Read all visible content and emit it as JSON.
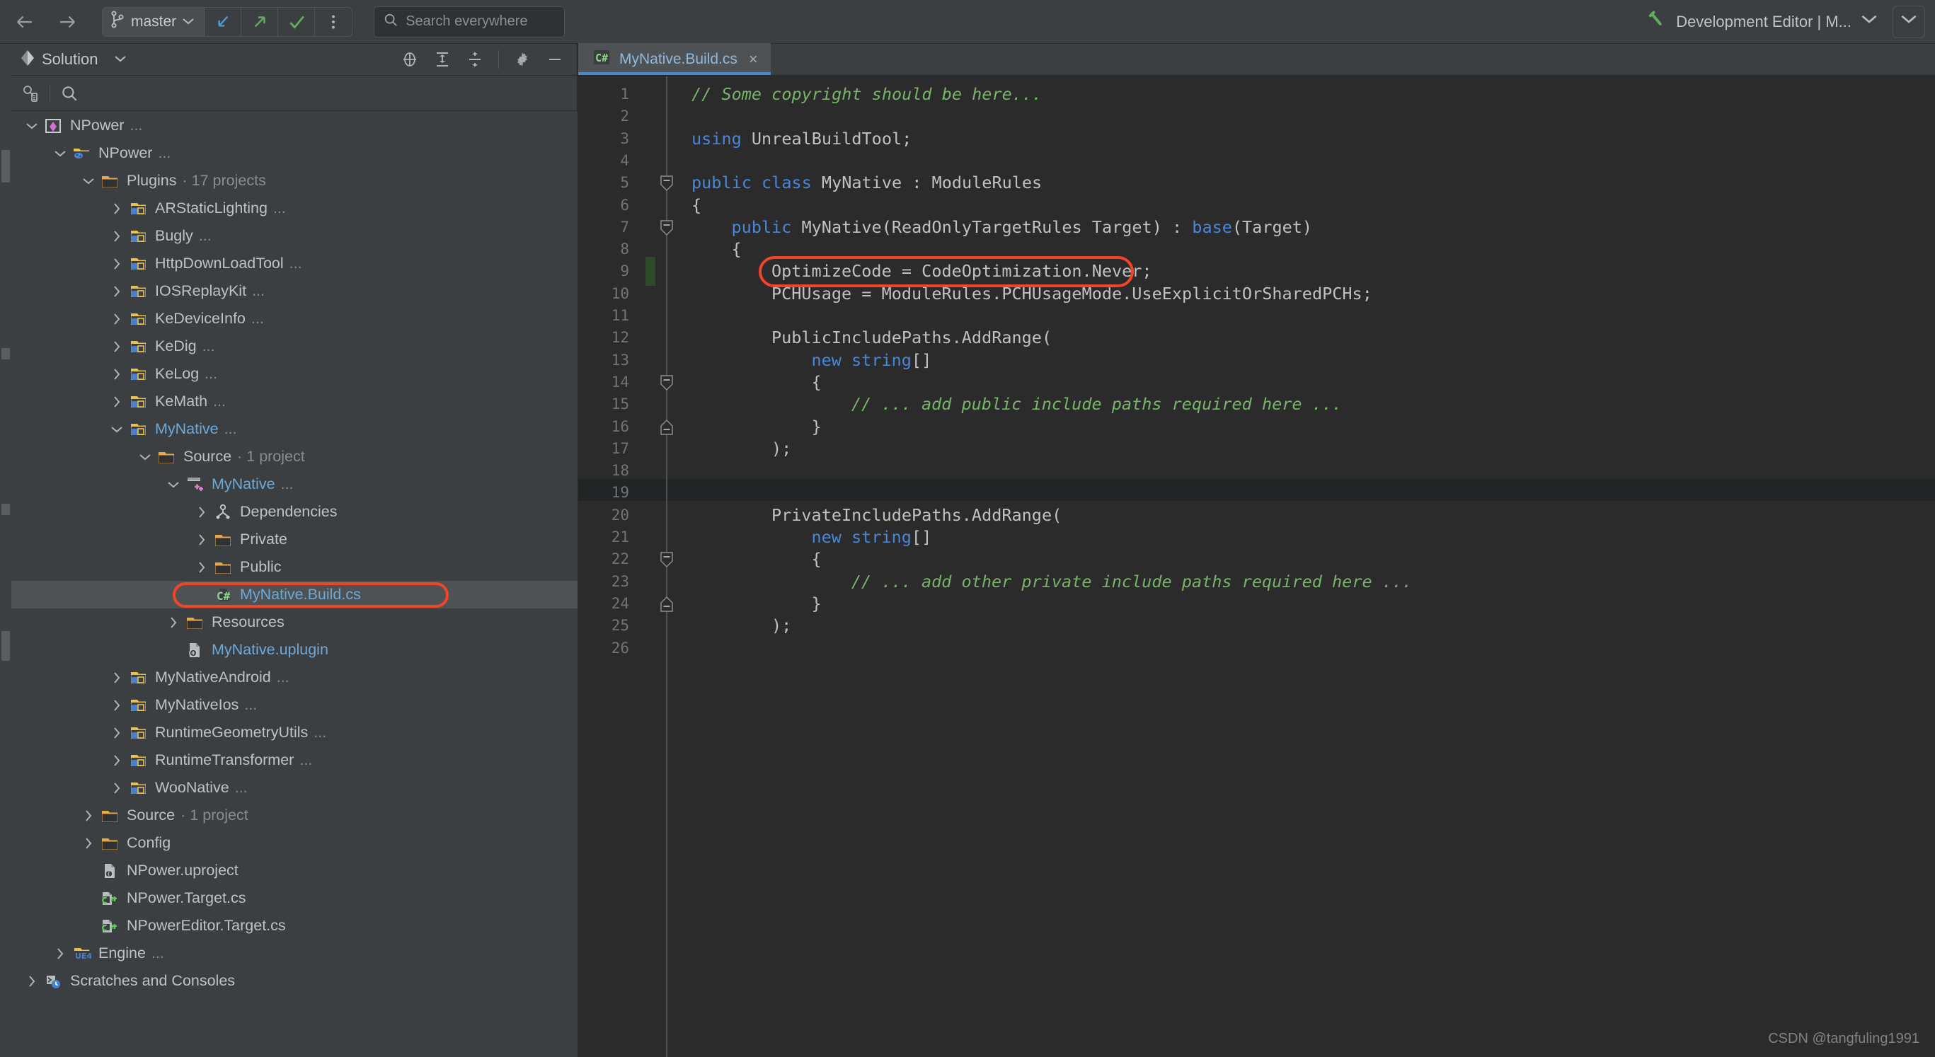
{
  "toolbar": {
    "back_icon": "arrow-left-icon",
    "forward_icon": "arrow-right-icon",
    "branch_label": "master",
    "branch_icon": "git-branch-icon",
    "update_icon": "update-project-icon",
    "push_icon": "push-commits-icon",
    "commit_icon": "commit-checkmark-icon",
    "more_icon": "more-vertical-icon",
    "search_placeholder": "Search everywhere",
    "search_icon": "search-icon",
    "run_config_label": "Development Editor | M...",
    "run_config_icon": "hammer-icon",
    "run_config_chevron": "chevron-down-icon",
    "right_chevron": "chevron-down-icon"
  },
  "solution": {
    "title": "Solution",
    "title_icon": "solution-diamond-icon",
    "title_chevron": "chevron-down-icon",
    "header_icons": [
      "locate-target-icon",
      "expand-all-icon",
      "collapse-all-icon",
      "settings-gear-icon",
      "minimize-icon"
    ],
    "toolbar_icons": [
      "sync-with-editor-icon",
      "search-icon"
    ],
    "tree": [
      {
        "indent": 0,
        "arrow": "down",
        "icon": "solution-icon",
        "label": "NPower",
        "suffix": "...",
        "color": "plain"
      },
      {
        "indent": 1,
        "arrow": "down",
        "icon": "game-folder-icon",
        "label": "NPower",
        "suffix": "...",
        "color": "plain"
      },
      {
        "indent": 2,
        "arrow": "down",
        "icon": "folder-icon",
        "label": "Plugins",
        "suffix": "· 17 projects",
        "color": "plain"
      },
      {
        "indent": 3,
        "arrow": "right",
        "icon": "plugin-icon",
        "label": "ARStaticLighting",
        "suffix": "...",
        "color": "plain"
      },
      {
        "indent": 3,
        "arrow": "right",
        "icon": "plugin-icon",
        "label": "Bugly",
        "suffix": "...",
        "color": "plain"
      },
      {
        "indent": 3,
        "arrow": "right",
        "icon": "plugin-icon",
        "label": "HttpDownLoadTool",
        "suffix": "...",
        "color": "plain"
      },
      {
        "indent": 3,
        "arrow": "right",
        "icon": "plugin-icon",
        "label": "IOSReplayKit",
        "suffix": "...",
        "color": "plain"
      },
      {
        "indent": 3,
        "arrow": "right",
        "icon": "plugin-icon",
        "label": "KeDeviceInfo",
        "suffix": "...",
        "color": "plain"
      },
      {
        "indent": 3,
        "arrow": "right",
        "icon": "plugin-icon",
        "label": "KeDig",
        "suffix": "...",
        "color": "plain"
      },
      {
        "indent": 3,
        "arrow": "right",
        "icon": "plugin-icon",
        "label": "KeLog",
        "suffix": "...",
        "color": "plain"
      },
      {
        "indent": 3,
        "arrow": "right",
        "icon": "plugin-icon",
        "label": "KeMath",
        "suffix": "...",
        "color": "plain"
      },
      {
        "indent": 3,
        "arrow": "down",
        "icon": "plugin-icon",
        "label": "MyNative",
        "suffix": "...",
        "color": "blue"
      },
      {
        "indent": 4,
        "arrow": "down",
        "icon": "folder-icon",
        "label": "Source",
        "suffix": "· 1 project",
        "color": "plain"
      },
      {
        "indent": 5,
        "arrow": "down",
        "icon": "cpp-module-icon",
        "label": "MyNative",
        "suffix": "...",
        "color": "blue"
      },
      {
        "indent": 6,
        "arrow": "right",
        "icon": "dependencies-icon",
        "label": "Dependencies",
        "suffix": "",
        "color": "plain"
      },
      {
        "indent": 6,
        "arrow": "right",
        "icon": "folder-icon",
        "label": "Private",
        "suffix": "",
        "color": "plain"
      },
      {
        "indent": 6,
        "arrow": "right",
        "icon": "folder-icon",
        "label": "Public",
        "suffix": "",
        "color": "plain"
      },
      {
        "indent": 6,
        "arrow": "none",
        "icon": "csharp-file-icon",
        "label": "MyNative.Build.cs",
        "suffix": "",
        "color": "blue",
        "selected": true,
        "highlighted": true
      },
      {
        "indent": 5,
        "arrow": "right",
        "icon": "folder-icon",
        "label": "Resources",
        "suffix": "",
        "color": "plain"
      },
      {
        "indent": 5,
        "arrow": "none",
        "icon": "uplugin-icon",
        "label": "MyNative.uplugin",
        "suffix": "",
        "color": "blue"
      },
      {
        "indent": 3,
        "arrow": "right",
        "icon": "plugin-icon",
        "label": "MyNativeAndroid",
        "suffix": "...",
        "color": "plain"
      },
      {
        "indent": 3,
        "arrow": "right",
        "icon": "plugin-icon",
        "label": "MyNativeIos",
        "suffix": "...",
        "color": "plain"
      },
      {
        "indent": 3,
        "arrow": "right",
        "icon": "plugin-icon",
        "label": "RuntimeGeometryUtils",
        "suffix": "...",
        "color": "plain"
      },
      {
        "indent": 3,
        "arrow": "right",
        "icon": "plugin-icon",
        "label": "RuntimeTransformer",
        "suffix": "...",
        "color": "plain"
      },
      {
        "indent": 3,
        "arrow": "right",
        "icon": "plugin-icon",
        "label": "WooNative",
        "suffix": "...",
        "color": "plain"
      },
      {
        "indent": 2,
        "arrow": "right",
        "icon": "folder-icon",
        "label": "Source",
        "suffix": "· 1 project",
        "color": "plain"
      },
      {
        "indent": 2,
        "arrow": "right",
        "icon": "folder-icon",
        "label": "Config",
        "suffix": "",
        "color": "plain"
      },
      {
        "indent": 2,
        "arrow": "none",
        "icon": "uproject-icon",
        "label": "NPower.uproject",
        "suffix": "",
        "color": "plain"
      },
      {
        "indent": 2,
        "arrow": "none",
        "icon": "cs-target-icon",
        "label": "NPower.Target.cs",
        "suffix": "",
        "color": "plain"
      },
      {
        "indent": 2,
        "arrow": "none",
        "icon": "cs-target-icon",
        "label": "NPowerEditor.Target.cs",
        "suffix": "",
        "color": "plain"
      },
      {
        "indent": 1,
        "arrow": "right",
        "icon": "ue4-folder-icon",
        "label": "Engine",
        "suffix": "...",
        "color": "plain"
      },
      {
        "indent": 0,
        "arrow": "right",
        "icon": "scratches-icon",
        "label": "Scratches and Consoles",
        "suffix": "",
        "color": "plain"
      }
    ]
  },
  "editor": {
    "tab": {
      "label": "MyNative.Build.cs",
      "icon": "csharp-file-icon",
      "close": "×"
    },
    "current_line": 19,
    "changed_line": 9,
    "highlight_box_line": 9,
    "lines": [
      {
        "n": 1,
        "indent": 0,
        "tokens": [
          {
            "t": "// Some copyright should be here...",
            "c": "c"
          }
        ]
      },
      {
        "n": 2,
        "indent": 0,
        "tokens": []
      },
      {
        "n": 3,
        "indent": 0,
        "tokens": [
          {
            "t": "using",
            "c": "k"
          },
          {
            "t": " UnrealBuildTool;",
            "c": "p"
          }
        ]
      },
      {
        "n": 4,
        "indent": 0,
        "tokens": []
      },
      {
        "n": 5,
        "indent": 0,
        "tokens": [
          {
            "t": "public class",
            "c": "k"
          },
          {
            "t": " MyNative : ModuleRules",
            "c": "p"
          }
        ],
        "fold": "start"
      },
      {
        "n": 6,
        "indent": 0,
        "tokens": [
          {
            "t": "{",
            "c": "p"
          }
        ]
      },
      {
        "n": 7,
        "indent": 1,
        "tokens": [
          {
            "t": "public",
            "c": "k"
          },
          {
            "t": " MyNative(ReadOnlyTargetRules Target) : ",
            "c": "p"
          },
          {
            "t": "base",
            "c": "k"
          },
          {
            "t": "(Target)",
            "c": "p"
          }
        ],
        "fold": "start"
      },
      {
        "n": 8,
        "indent": 1,
        "tokens": [
          {
            "t": "{",
            "c": "p"
          }
        ]
      },
      {
        "n": 9,
        "indent": 2,
        "tokens": [
          {
            "t": "OptimizeCode = CodeOptimization.Never;",
            "c": "p"
          }
        ]
      },
      {
        "n": 10,
        "indent": 2,
        "tokens": [
          {
            "t": "PCHUsage = ModuleRules.PCHUsageMode.UseExplicitOrSharedPCHs;",
            "c": "p"
          }
        ]
      },
      {
        "n": 11,
        "indent": 0,
        "tokens": []
      },
      {
        "n": 12,
        "indent": 2,
        "tokens": [
          {
            "t": "PublicIncludePaths.AddRange(",
            "c": "p"
          }
        ]
      },
      {
        "n": 13,
        "indent": 3,
        "tokens": [
          {
            "t": "new string",
            "c": "k"
          },
          {
            "t": "[]",
            "c": "p"
          }
        ]
      },
      {
        "n": 14,
        "indent": 3,
        "tokens": [
          {
            "t": "{",
            "c": "p"
          }
        ],
        "fold": "start"
      },
      {
        "n": 15,
        "indent": 4,
        "tokens": [
          {
            "t": "// ... add public include paths required here ...",
            "c": "c"
          }
        ]
      },
      {
        "n": 16,
        "indent": 3,
        "tokens": [
          {
            "t": "}",
            "c": "p"
          }
        ],
        "fold": "end"
      },
      {
        "n": 17,
        "indent": 2,
        "tokens": [
          {
            "t": ");",
            "c": "p"
          }
        ]
      },
      {
        "n": 18,
        "indent": 0,
        "tokens": []
      },
      {
        "n": 19,
        "indent": 0,
        "tokens": []
      },
      {
        "n": 20,
        "indent": 2,
        "tokens": [
          {
            "t": "PrivateIncludePaths.AddRange(",
            "c": "p"
          }
        ]
      },
      {
        "n": 21,
        "indent": 3,
        "tokens": [
          {
            "t": "new string",
            "c": "k"
          },
          {
            "t": "[]",
            "c": "p"
          }
        ]
      },
      {
        "n": 22,
        "indent": 3,
        "tokens": [
          {
            "t": "{",
            "c": "p"
          }
        ],
        "fold": "start"
      },
      {
        "n": 23,
        "indent": 4,
        "tokens": [
          {
            "t": "// ... add other private include paths required here ...",
            "c": "c"
          }
        ]
      },
      {
        "n": 24,
        "indent": 3,
        "tokens": [
          {
            "t": "}",
            "c": "p"
          }
        ],
        "fold": "end"
      },
      {
        "n": 25,
        "indent": 2,
        "tokens": [
          {
            "t": ");",
            "c": "p"
          }
        ]
      },
      {
        "n": 26,
        "indent": 0,
        "tokens": []
      }
    ]
  },
  "watermark": "CSDN @tangfuling1991",
  "colors": {
    "accent_blue": "#4a88c7",
    "highlight_red": "#f04527",
    "comment_green": "#78b36a",
    "keyword_blue": "#4a86d8",
    "panel_bg": "#3c3f41",
    "editor_bg": "#2b2b2b",
    "selection_bg": "#4e5254"
  }
}
